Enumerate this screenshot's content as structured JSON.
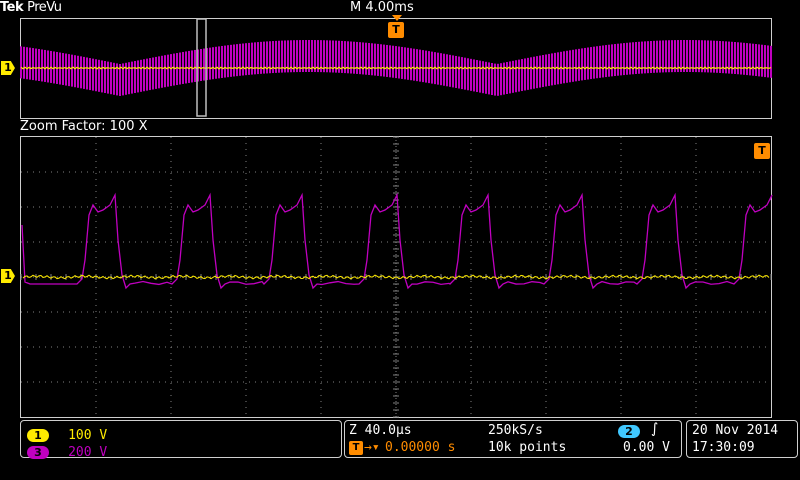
{
  "header": {
    "brand": "Tek",
    "mode": "PreVu",
    "horizontal_scale": "M 4.00ms"
  },
  "zoom": {
    "label": "Zoom Factor: 100 X"
  },
  "markers": {
    "ch1": "1",
    "trigger": "T"
  },
  "channels": [
    {
      "number": "1",
      "scale": "100 V",
      "color": "#ffeb00"
    },
    {
      "number": "3",
      "scale": "200 V",
      "color": "#c000c0"
    }
  ],
  "acquisition": {
    "zoom_scale": "Z 40.0µs",
    "trigger_position": "0.00000 s",
    "sample_rate": "250kS/s",
    "record_length": "10k points",
    "trigger_source": "2",
    "trigger_level": "0.00 V"
  },
  "datetime": {
    "date": "20 Nov 2014",
    "time": "17:30:09"
  },
  "colors": {
    "ch1": "#ffeb00",
    "ch3": "#c000c0",
    "trigger": "#ff8c00",
    "grid": "#808080"
  }
}
